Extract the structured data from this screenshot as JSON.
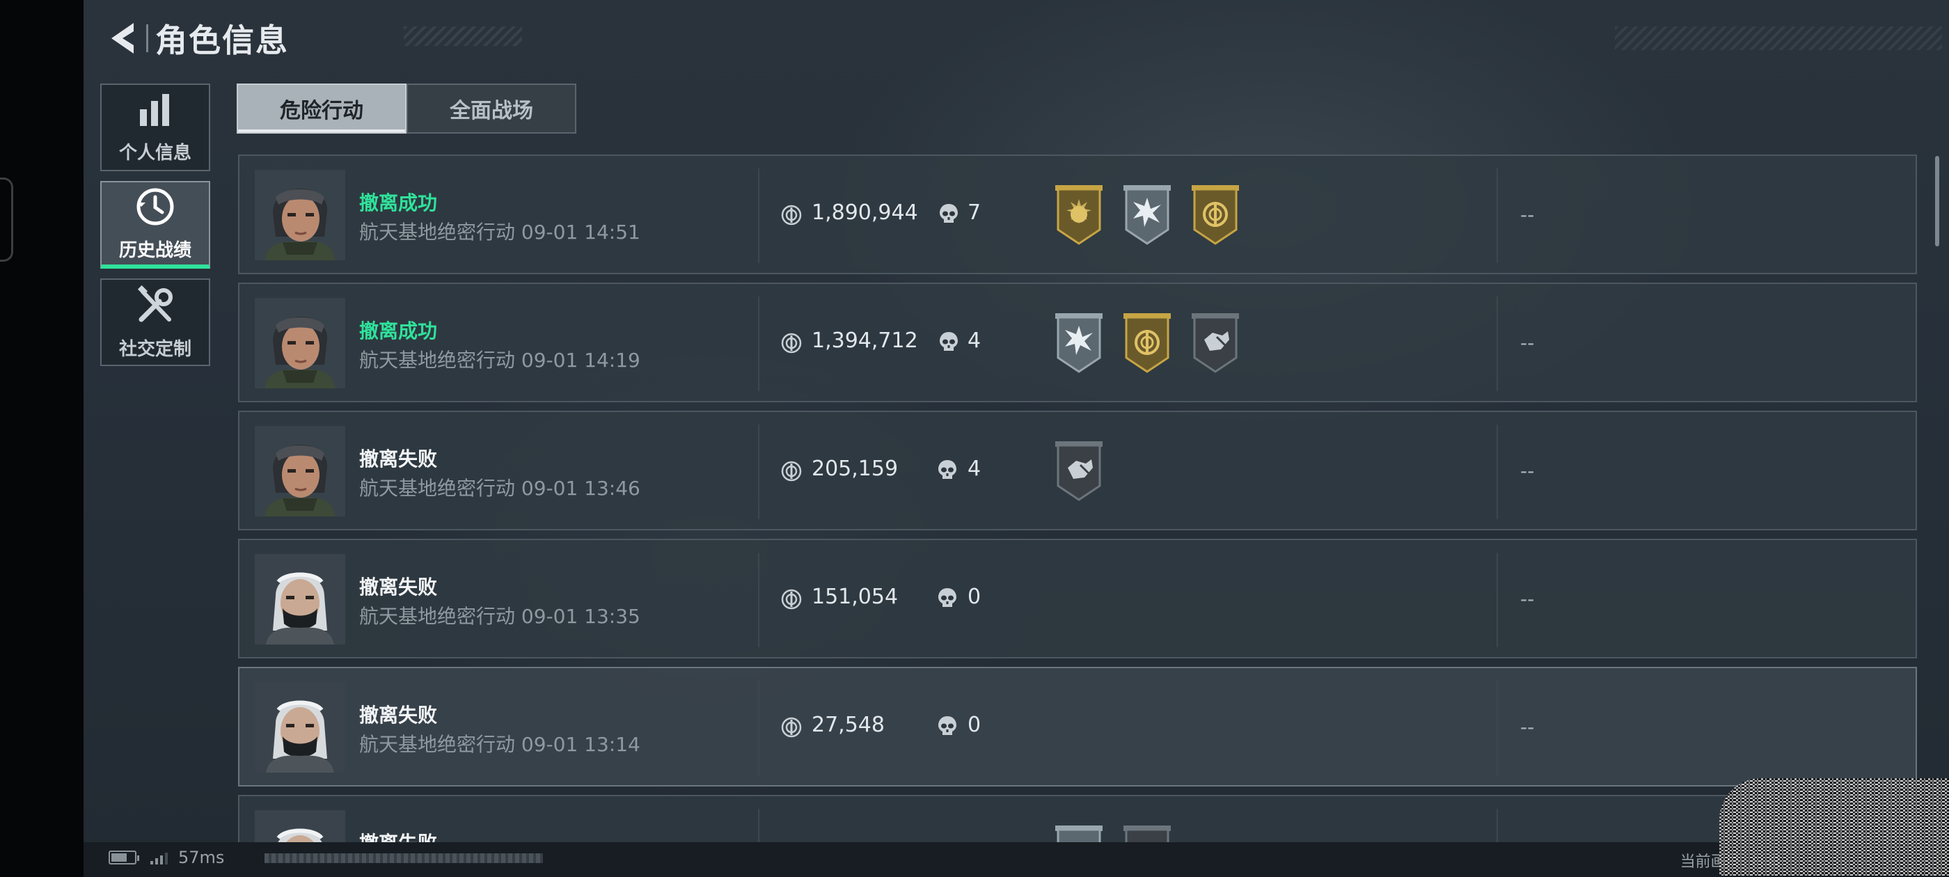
{
  "header": {
    "title": "角色信息"
  },
  "nav": [
    {
      "label": "个人信息",
      "icon": "bar-chart-icon"
    },
    {
      "label": "历史战绩",
      "icon": "history-clock-icon",
      "active": true
    },
    {
      "label": "社交定制",
      "icon": "tools-wrench-icon"
    }
  ],
  "tabs": [
    {
      "label": "危险行动",
      "active": true
    },
    {
      "label": "全面战场",
      "active": false
    }
  ],
  "records": [
    {
      "status": "撤离成功",
      "success": true,
      "detail": "航天基地绝密行动 09-01 14:51",
      "value": "1,890,944",
      "kills": "7",
      "extra": "--",
      "avatar": "female-operator-green",
      "badges": [
        "gold-sun-badge",
        "silver-burst-badge",
        "gold-coin-badge"
      ]
    },
    {
      "status": "撤离成功",
      "success": true,
      "detail": "航天基地绝密行动 09-01 14:19",
      "value": "1,394,712",
      "kills": "4",
      "extra": "--",
      "avatar": "female-operator-green",
      "badges": [
        "silver-burst-badge",
        "gold-coin-badge",
        "dark-hand-badge"
      ]
    },
    {
      "status": "撤离失败",
      "success": false,
      "detail": "航天基地绝密行动 09-01 13:46",
      "value": "205,159",
      "kills": "4",
      "extra": "--",
      "avatar": "female-operator-green",
      "badges": [
        "dark-hand-badge"
      ]
    },
    {
      "status": "撤离失败",
      "success": false,
      "detail": "航天基地绝密行动 09-01 13:35",
      "value": "151,054",
      "kills": "0",
      "extra": "--",
      "avatar": "masked-operator-white",
      "badges": []
    },
    {
      "status": "撤离失败",
      "success": false,
      "detail": "航天基地绝密行动 09-01 13:14",
      "value": "27,548",
      "kills": "0",
      "extra": "--",
      "avatar": "masked-operator-white",
      "badges": []
    },
    {
      "status": "撤离失败",
      "success": false,
      "detail": "",
      "value": "",
      "kills": "",
      "extra": "",
      "avatar": "masked-operator-white",
      "badges": [
        "silver-badge",
        "dark-badge"
      ]
    }
  ],
  "footer": {
    "ping": "57ms",
    "quality": "当前画质: 标准"
  },
  "colors": {
    "success": "#2fe29b",
    "failure": "#f2f4f6",
    "gold": "#c7a544",
    "silver": "#8c979f"
  }
}
